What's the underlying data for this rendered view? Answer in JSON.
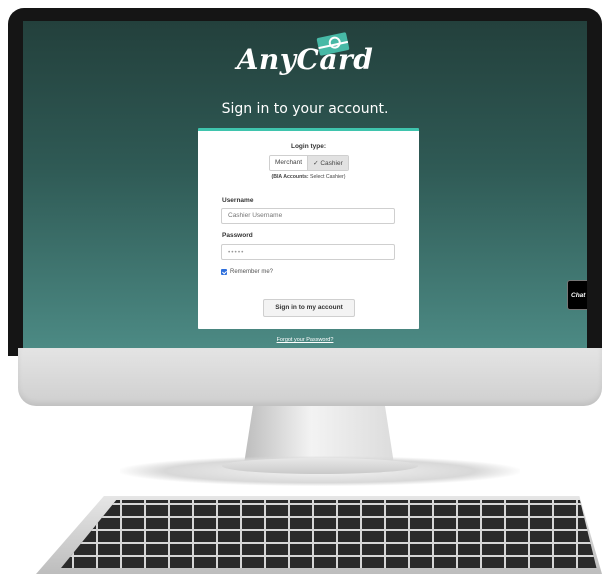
{
  "brand": {
    "logo_text": "AnyCard"
  },
  "page": {
    "headline": "Sign in to your account."
  },
  "login": {
    "type_label": "Login type:",
    "options": [
      "Merchant",
      "✓ Cashier"
    ],
    "selected": "Cashier",
    "note_bold": "(BIA Accounts:",
    "note_rest": " Select Cashier)",
    "username_label": "Username",
    "username_placeholder": "Cashier Username",
    "password_label": "Password",
    "password_value": "•••••",
    "remember_label": "Remember me?",
    "remember_checked": true,
    "submit_label": "Sign in to my account",
    "forgot_label": "Forgot your Password?"
  },
  "chat": {
    "label": "Chat wi"
  },
  "colors": {
    "accent": "#3fc4ad",
    "background_top": "#23403c",
    "background_bottom": "#4c8a84"
  }
}
